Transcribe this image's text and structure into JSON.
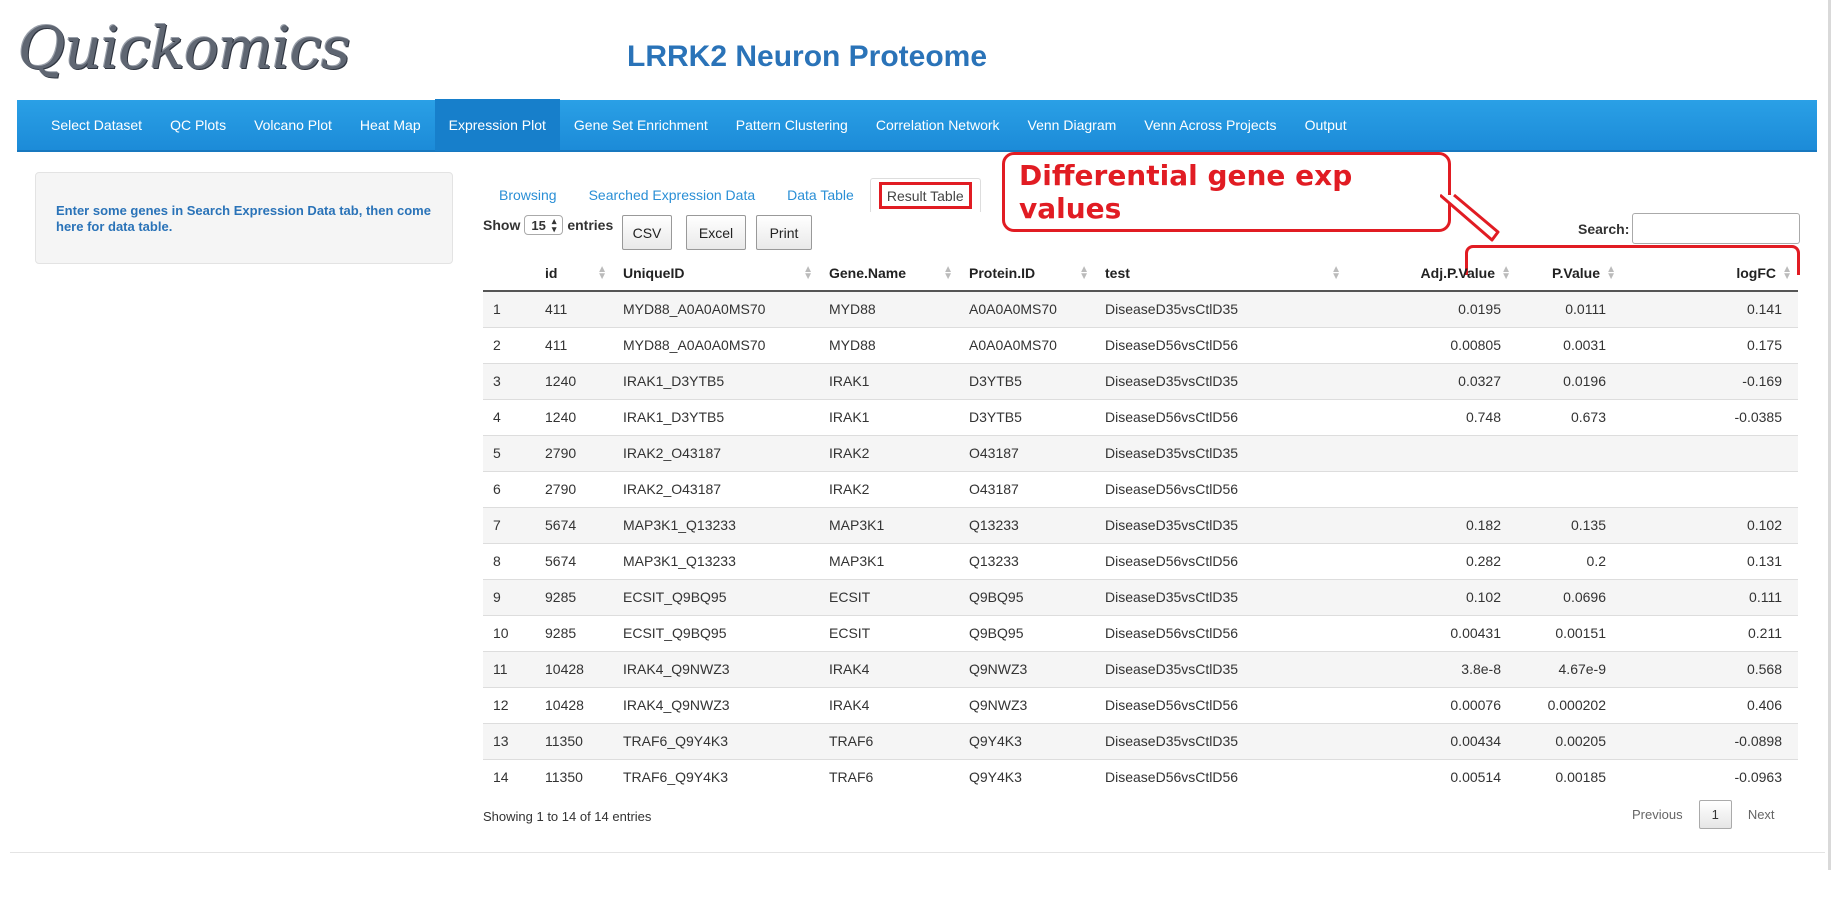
{
  "app": {
    "logo": "Quickomics",
    "title": "LRRK2 Neuron Proteome"
  },
  "nav": [
    "Select Dataset",
    "QC Plots",
    "Volcano Plot",
    "Heat Map",
    "Expression Plot",
    "Gene Set Enrichment",
    "Pattern Clustering",
    "Correlation Network",
    "Venn Diagram",
    "Venn Across Projects",
    "Output"
  ],
  "nav_active": "Expression Plot",
  "sidebar": {
    "message": "Enter some genes in Search Expression Data tab, then come here for data table."
  },
  "subtabs": [
    "Browsing",
    "Searched Expression Data",
    "Data Table",
    "Result Table"
  ],
  "subtab_active": "Result Table",
  "annotation": {
    "callout": "Differential gene exp values",
    "color": "#e11c23"
  },
  "controls": {
    "show_label": "Show",
    "page_length": "15",
    "entries_label": "entries",
    "buttons": [
      "CSV",
      "Excel",
      "Print"
    ],
    "search_label": "Search:",
    "search_value": ""
  },
  "table": {
    "columns": [
      "",
      "id",
      "UniqueID",
      "Gene.Name",
      "Protein.ID",
      "test",
      "Adj.P.Value",
      "P.Value",
      "logFC"
    ],
    "rows": [
      [
        "1",
        "411",
        "MYD88_A0A0A0MS70",
        "MYD88",
        "A0A0A0MS70",
        "DiseaseD35vsCtlD35",
        "0.0195",
        "0.0111",
        "0.141"
      ],
      [
        "2",
        "411",
        "MYD88_A0A0A0MS70",
        "MYD88",
        "A0A0A0MS70",
        "DiseaseD56vsCtlD56",
        "0.00805",
        "0.0031",
        "0.175"
      ],
      [
        "3",
        "1240",
        "IRAK1_D3YTB5",
        "IRAK1",
        "D3YTB5",
        "DiseaseD35vsCtlD35",
        "0.0327",
        "0.0196",
        "-0.169"
      ],
      [
        "4",
        "1240",
        "IRAK1_D3YTB5",
        "IRAK1",
        "D3YTB5",
        "DiseaseD56vsCtlD56",
        "0.748",
        "0.673",
        "-0.0385"
      ],
      [
        "5",
        "2790",
        "IRAK2_O43187",
        "IRAK2",
        "O43187",
        "DiseaseD35vsCtlD35",
        "",
        "",
        ""
      ],
      [
        "6",
        "2790",
        "IRAK2_O43187",
        "IRAK2",
        "O43187",
        "DiseaseD56vsCtlD56",
        "",
        "",
        ""
      ],
      [
        "7",
        "5674",
        "MAP3K1_Q13233",
        "MAP3K1",
        "Q13233",
        "DiseaseD35vsCtlD35",
        "0.182",
        "0.135",
        "0.102"
      ],
      [
        "8",
        "5674",
        "MAP3K1_Q13233",
        "MAP3K1",
        "Q13233",
        "DiseaseD56vsCtlD56",
        "0.282",
        "0.2",
        "0.131"
      ],
      [
        "9",
        "9285",
        "ECSIT_Q9BQ95",
        "ECSIT",
        "Q9BQ95",
        "DiseaseD35vsCtlD35",
        "0.102",
        "0.0696",
        "0.111"
      ],
      [
        "10",
        "9285",
        "ECSIT_Q9BQ95",
        "ECSIT",
        "Q9BQ95",
        "DiseaseD56vsCtlD56",
        "0.00431",
        "0.00151",
        "0.211"
      ],
      [
        "11",
        "10428",
        "IRAK4_Q9NWZ3",
        "IRAK4",
        "Q9NWZ3",
        "DiseaseD35vsCtlD35",
        "3.8e-8",
        "4.67e-9",
        "0.568"
      ],
      [
        "12",
        "10428",
        "IRAK4_Q9NWZ3",
        "IRAK4",
        "Q9NWZ3",
        "DiseaseD56vsCtlD56",
        "0.00076",
        "0.000202",
        "0.406"
      ],
      [
        "13",
        "11350",
        "TRAF6_Q9Y4K3",
        "TRAF6",
        "Q9Y4K3",
        "DiseaseD35vsCtlD35",
        "0.00434",
        "0.00205",
        "-0.0898"
      ],
      [
        "14",
        "11350",
        "TRAF6_Q9Y4K3",
        "TRAF6",
        "Q9Y4K3",
        "DiseaseD56vsCtlD56",
        "0.00514",
        "0.00185",
        "-0.0963"
      ]
    ]
  },
  "footer": {
    "info": "Showing 1 to 14 of 14 entries",
    "prev": "Previous",
    "page": "1",
    "next": "Next"
  }
}
